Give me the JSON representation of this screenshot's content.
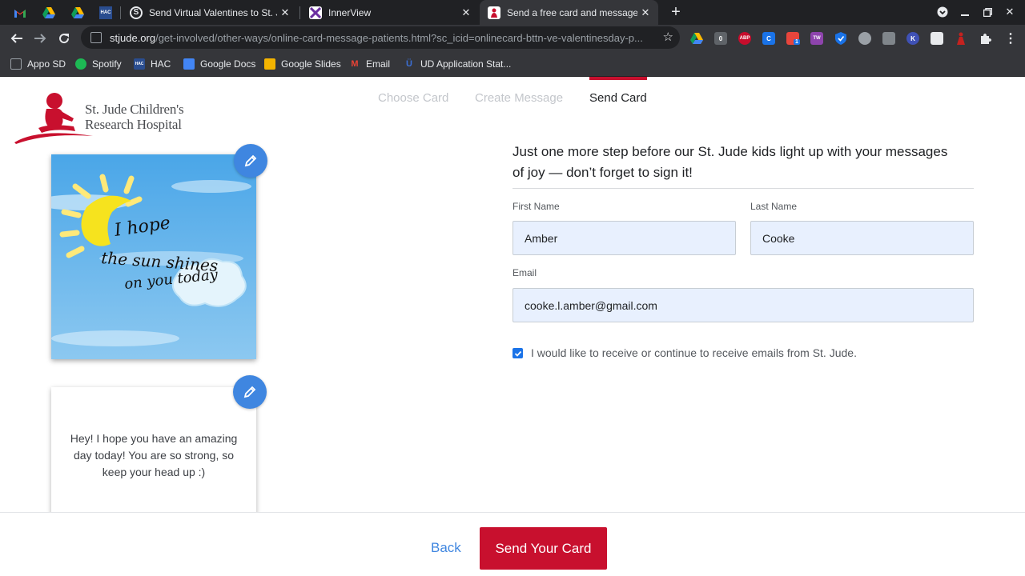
{
  "browser": {
    "pinned_tabs": [
      {
        "name": "gmail",
        "label": "M"
      },
      {
        "name": "google-drive",
        "label": ""
      },
      {
        "name": "google-drive-2",
        "label": ""
      },
      {
        "name": "hac",
        "label": "HAC"
      }
    ],
    "tabs": [
      {
        "title": "Send Virtual Valentines to St. Ju",
        "favicon": "S",
        "active": false
      },
      {
        "title": "InnerView",
        "favicon": "",
        "active": false
      },
      {
        "title": "Send a free card and message to",
        "favicon": "",
        "active": true
      }
    ],
    "url_domain": "stjude.org",
    "url_path": "/get-involved/other-ways/online-card-message-patients.html?sc_icid=onlinecard-bttn-ve-valentinesday-p...",
    "extensions": [
      {
        "name": "drive",
        "color": "#1fa463",
        "label": ""
      },
      {
        "name": "zero",
        "color": "#5f6368",
        "label": "0"
      },
      {
        "name": "abp",
        "color": "#c70d2c",
        "label": "ABP"
      },
      {
        "name": "c",
        "color": "#1a73e8",
        "label": "C"
      },
      {
        "name": "red-ext",
        "color": "#e8453c",
        "label": "1"
      },
      {
        "name": "tw",
        "color": "#8e44ad",
        "label": "TW"
      },
      {
        "name": "shield",
        "color": "#1a73e8",
        "label": ""
      },
      {
        "name": "clock",
        "color": "#9aa0a6",
        "label": ""
      },
      {
        "name": "gray",
        "color": "#80868b",
        "label": ""
      },
      {
        "name": "k",
        "color": "#3f51b5",
        "label": "K"
      },
      {
        "name": "white",
        "color": "#e8eaed",
        "label": ""
      },
      {
        "name": "red-figure",
        "color": "#c5221f",
        "label": ""
      }
    ],
    "bookmarks": [
      {
        "label": "Appo SD",
        "icon_color": "#9aa0a6",
        "icon": ""
      },
      {
        "label": "Spotify",
        "icon_color": "#1db954",
        "icon": ""
      },
      {
        "label": "HAC",
        "icon_color": "#2a4d8f",
        "icon": "HAC"
      },
      {
        "label": "Google Docs",
        "icon_color": "#4285f4",
        "icon": ""
      },
      {
        "label": "Google Slides",
        "icon_color": "#f4b400",
        "icon": ""
      },
      {
        "label": "Email",
        "icon_color": "#ea4335",
        "icon": "M"
      },
      {
        "label": "UD Application Stat...",
        "icon_color": "#1b3c8c",
        "icon": ""
      }
    ]
  },
  "site": {
    "logo_line1": "St. Jude Children's",
    "logo_line2": "Research Hospital",
    "brand_color": "#c8102e",
    "steps": [
      "Choose Card",
      "Create Message",
      "Send Card"
    ],
    "current_step": "Send Card"
  },
  "card": {
    "image_text_line1": "I hope",
    "image_text_line2": "the sun shines",
    "image_text_line3": "on you today",
    "message": "Hey! I hope you have an amazing day today! You are so strong, so keep your head up :)"
  },
  "form": {
    "intro": "Just one more step before our St. Jude kids light up with your messages of joy — don’t forget to sign it!",
    "first_name_label": "First Name",
    "first_name_value": "Amber",
    "last_name_label": "Last Name",
    "last_name_value": "Cooke",
    "email_label": "Email",
    "email_value": "cooke.l.amber@gmail.com",
    "opt_in_checked": true,
    "opt_in_label": "I would like to receive or continue to receive emails from St. Jude."
  },
  "footer": {
    "back_label": "Back",
    "send_label": "Send Your Card"
  }
}
